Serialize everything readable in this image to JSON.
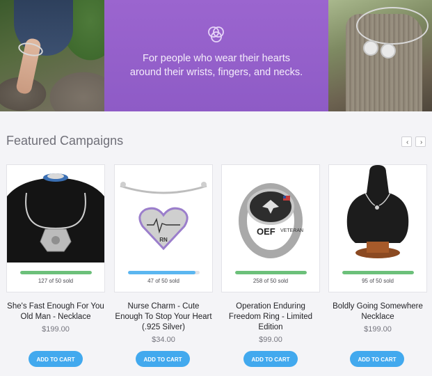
{
  "hero": {
    "tagline_line1": "For people who wear their hearts",
    "tagline_line2": "around their wrists, fingers, and necks.",
    "icon": "rings-icon",
    "accent_color": "#9461cb"
  },
  "featured": {
    "title": "Featured Campaigns",
    "prev_label": "‹",
    "next_label": "›"
  },
  "products": [
    {
      "title": "She's Fast Enough For You Old Man - Necklace",
      "price": "$199.00",
      "sold": "127 of 50 sold",
      "progress": 1.0,
      "progress_color": "#6cc07a",
      "cta": "ADD TO CART",
      "image": "spaceship-necklace"
    },
    {
      "title": "Nurse Charm - Cute Enough To Stop Your Heart (.925 Silver)",
      "price": "$34.00",
      "sold": "47 of 50 sold",
      "progress": 0.94,
      "progress_color": "#5bb6f0",
      "cta": "ADD TO CART",
      "image": "heart-bangle"
    },
    {
      "title": "Operation Enduring Freedom Ring - Limited Edition",
      "price": "$99.00",
      "sold": "258 of 50 sold",
      "progress": 1.0,
      "progress_color": "#6cc07a",
      "cta": "ADD TO CART",
      "image": "veteran-ring"
    },
    {
      "title": "Boldly Going Somewhere Necklace",
      "price": "$199.00",
      "sold": "95 of 50 sold",
      "progress": 1.0,
      "progress_color": "#6cc07a",
      "cta": "ADD TO CART",
      "image": "bust-necklace"
    }
  ]
}
